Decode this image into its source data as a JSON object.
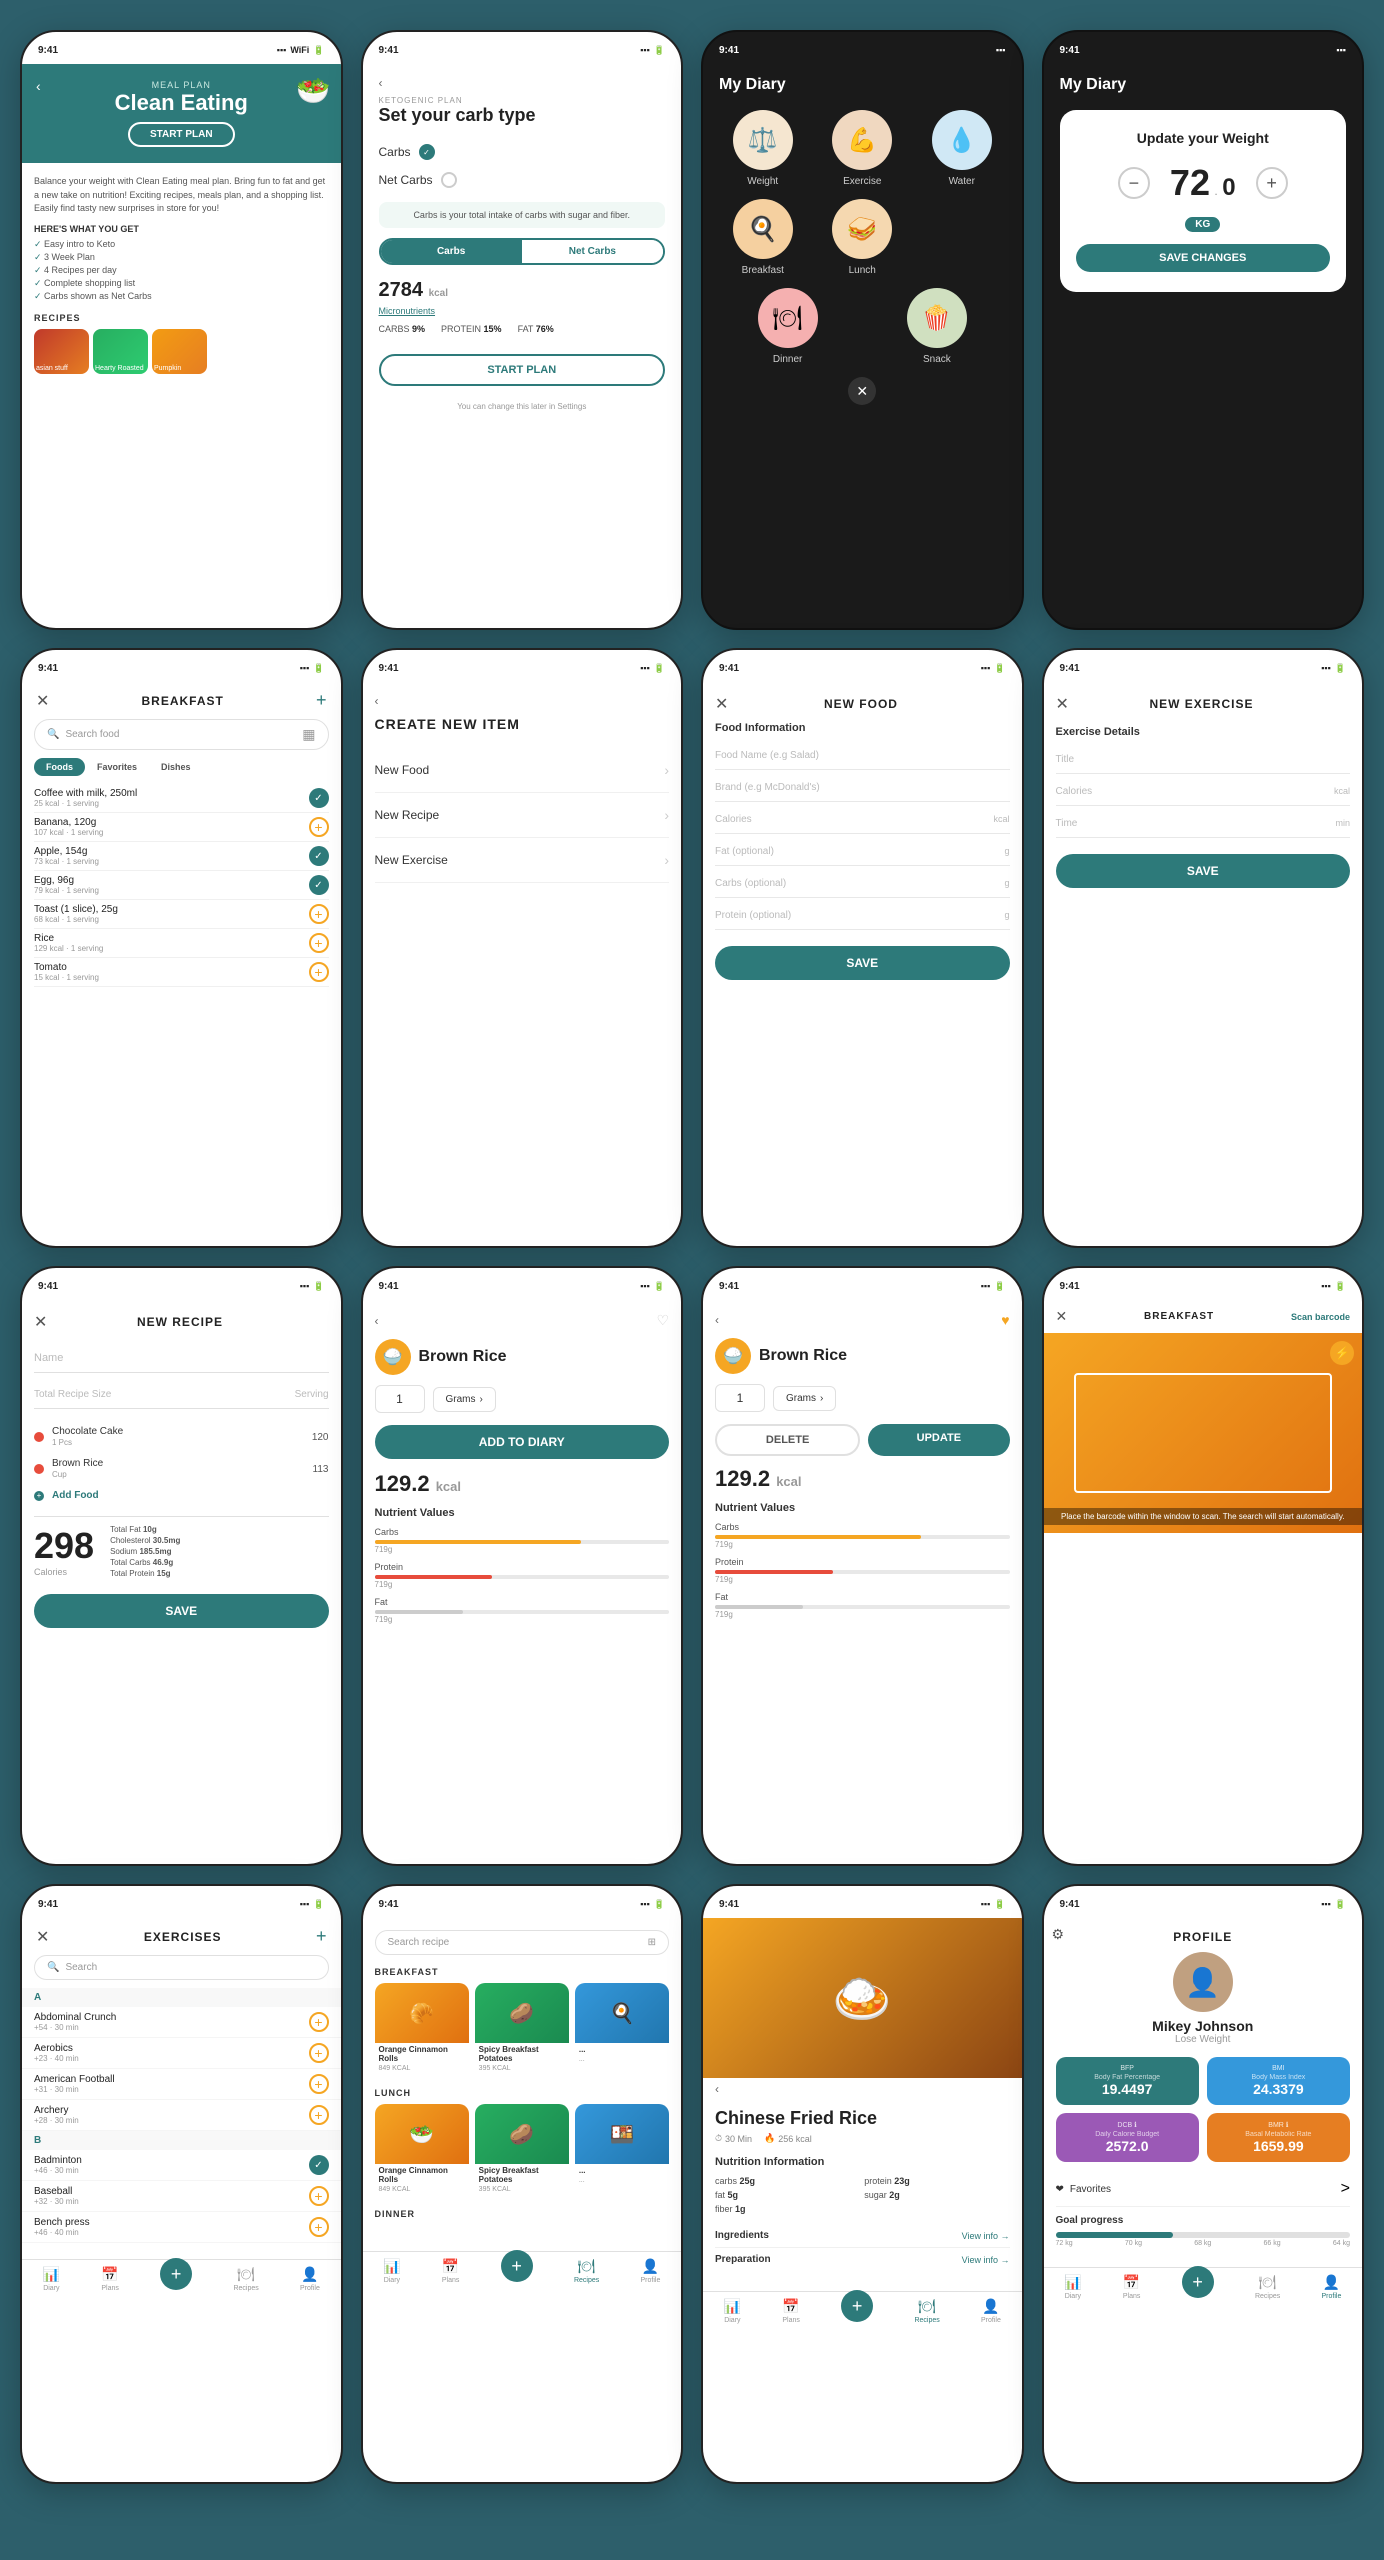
{
  "row1": {
    "screen1": {
      "label": "MEAL PLAN",
      "title": "Clean Eating",
      "start": "START PLAN",
      "body": "Balance your weight with Clean Eating meal plan. Bring fun to fat and get a new take on nutrition! Exciting recipes, meals plan, and a shopping list. Easily find tasty new surprises in store for you!",
      "hwyg": "HERE'S WHAT YOU GET",
      "checks": [
        "Easy intro to Keto",
        "3 Week Plan",
        "4 Recipes per day",
        "Complete shopping list",
        "Carbs shown as Net Carbs"
      ],
      "recipes": "RECIPES",
      "recipe1": "asian stuff",
      "recipe2": "Hearty Roasted Veggie Salad",
      "recipe3": "Pumpkin"
    },
    "screen2": {
      "back": "<",
      "label": "KETOGENIC PLAN",
      "title": "Set your carb type",
      "carbs": "Carbs",
      "netCarbs": "Net Carbs",
      "info": "Carbs is your total intake of carbs with sugar and fiber.",
      "toggle1": "Carbs",
      "toggle2": "Net Carbs",
      "kcal": "2784",
      "kcalUnit": "kcal",
      "microLink": "Micronutrients",
      "carbsPct": "CARBS   9%",
      "proteinPct": "PROTEIN  15%",
      "fatPct": "FAT  76%",
      "startPlan": "START PLAN",
      "note": "You can change this later in Settings"
    },
    "screen3": {
      "title": "My Diary",
      "weight": "Weight",
      "exercise": "Exercise",
      "water": "Water",
      "breakfast": "Breakfast",
      "lunch": "Lunch",
      "dinner": "Dinner",
      "snack": "Snack"
    },
    "screen4": {
      "title": "My Diary",
      "cardTitle": "Update your Weight",
      "value": "72",
      "decimal": "0",
      "unit": "KG",
      "saveBtn": "SAVE CHANGES"
    }
  },
  "row2": {
    "screen5": {
      "title": "BREAKFAST",
      "searchPlaceholder": "Search food",
      "tab1": "Foods",
      "tab2": "Favorites",
      "tab3": "Dishes",
      "foods": [
        {
          "name": "Coffee with milk, 250ml",
          "meta": "25 kcal · 1 serving",
          "checked": true
        },
        {
          "name": "Banana, 120g",
          "meta": "107 kcal · 1 serving",
          "checked": false
        },
        {
          "name": "Apple, 154g",
          "meta": "73 kcal · 1 serving",
          "checked": true
        },
        {
          "name": "Egg, 96g",
          "meta": "79 kcal · 1 serving",
          "checked": true
        },
        {
          "name": "Toast (1 slice), 25g",
          "meta": "68 kcal · 1 serving",
          "checked": false
        },
        {
          "name": "Rice",
          "meta": "129 kcal · 1 serving",
          "checked": false
        },
        {
          "name": "Tomato",
          "meta": "15 kcal · 1 serving",
          "checked": false
        }
      ]
    },
    "screen6": {
      "back": "<",
      "title": "CREATE NEW ITEM",
      "option1": "New Food",
      "option2": "New Recipe",
      "option3": "New Exercise"
    },
    "screen7": {
      "close": "×",
      "title": "NEW FOOD",
      "sectionTitle": "Food Information",
      "field1": "Food Name (e.g Salad)",
      "field2": "Brand (e.g McDonald's)",
      "field3": "Calories",
      "field3Unit": "kcal",
      "field4": "Fat (optional)",
      "field4Unit": "g",
      "field5": "Carbs (optional)",
      "field5Unit": "g",
      "field6": "Protein (optional)",
      "field6Unit": "g",
      "saveBtn": "SAVE"
    },
    "screen8": {
      "close": "×",
      "title": "NEW EXERCISE",
      "sectionTitle": "Exercise Details",
      "field1": "Title",
      "field2": "Calories",
      "field2Unit": "kcal",
      "field3": "Time",
      "field3Unit": "min",
      "saveBtn": "SAVE"
    }
  },
  "row3": {
    "screen9": {
      "close": "×",
      "title": "NEW RECIPE",
      "namePlaceholder": "Name",
      "sizeLabel": "Total Recipe Size",
      "sizeUnit": "Serving",
      "foods": [
        {
          "color": "red",
          "name": "Chocolate Cake",
          "sub": "1 Pcs",
          "cal": 120
        },
        {
          "color": "red",
          "name": "Brown Rice",
          "sub": "Cup",
          "cal": 113
        }
      ],
      "addFood": "Add Food",
      "totalCal": "298",
      "calLabel": "Calories",
      "stats": [
        {
          "label": "Total Fat",
          "val": "10g"
        },
        {
          "label": "Cholesterol",
          "val": "30.5mg"
        },
        {
          "label": "Sodium",
          "val": "185.5mg"
        },
        {
          "label": "Total Carbs",
          "val": "46.9g"
        },
        {
          "label": "Total Protein",
          "val": "15g"
        }
      ],
      "saveBtn": "SAVE"
    },
    "screen10": {
      "back": "<",
      "heartIcon": "♡",
      "foodName": "Brown Rice",
      "qty": "1",
      "unit": "Grams",
      "addBtn": "ADD TO DIARY",
      "kcal": "129.2",
      "kcalUnit": "kcal",
      "nutrientsTitle": "Nutrient Values",
      "nutrients": [
        {
          "name": "Carbs",
          "val": "719g",
          "pct": 70
        },
        {
          "name": "Protein",
          "val": "719g",
          "pct": 40
        },
        {
          "name": "Fat",
          "val": "719g",
          "pct": 30
        }
      ]
    },
    "screen11": {
      "back": "<",
      "heartIcon": "♡",
      "foodName": "Brown Rice",
      "qty": "1",
      "unit": "Grams",
      "deleteBtn": "DELETE",
      "updateBtn": "UPDATE",
      "kcal": "129.2",
      "kcalUnit": "kcal",
      "nutrientsTitle": "Nutrient Values",
      "nutrients": [
        {
          "name": "Carbs",
          "val": "719g",
          "pct": 70
        },
        {
          "name": "Protein",
          "val": "719g",
          "pct": 40
        },
        {
          "name": "Fat",
          "val": "719g",
          "pct": 30
        }
      ]
    },
    "screen12": {
      "close": "×",
      "title": "BREAKFAST",
      "scanLink": "Scan barcode",
      "scanNote": "Place the barcode within the window to scan. The search will start automatically.",
      "lightning": "⚡"
    }
  },
  "row4": {
    "screen13": {
      "close": "×",
      "title": "EXERCISES",
      "plus": "+",
      "searchPlaceholder": "Search",
      "sections": [
        {
          "letter": "A",
          "items": [
            {
              "name": "Abdominal Crunch",
              "meta": "+54 · 30 min",
              "checked": false
            },
            {
              "name": "Aerobics",
              "meta": "+23 · 40 min",
              "checked": false
            },
            {
              "name": "American Football",
              "meta": "+31 · 30 min",
              "checked": false
            },
            {
              "name": "Archery",
              "meta": "+28 · 30 min",
              "checked": false
            }
          ]
        },
        {
          "letter": "B",
          "items": [
            {
              "name": "Badminton",
              "meta": "+46 · 30 min",
              "checked": true
            },
            {
              "name": "Baseball",
              "meta": "+32 · 30 min",
              "checked": false
            },
            {
              "name": "Bench press",
              "meta": "+46 · 40 min",
              "checked": false
            }
          ]
        }
      ]
    },
    "screen14": {
      "searchPlaceholder": "Search recipe",
      "sections": [
        {
          "title": "BREAKFAST",
          "cards": [
            {
              "name": "Orange Cinnamon Rolls",
              "cal": "849 KCAL",
              "emoji": "🥐"
            },
            {
              "name": "Spicy Breakfast Potatoes",
              "cal": "395 KCAL",
              "emoji": "🥔"
            },
            {
              "name": "...",
              "cal": "...",
              "emoji": "🍳"
            }
          ]
        },
        {
          "title": "LUNCH",
          "cards": [
            {
              "name": "Orange Cinnamon Rolls",
              "cal": "849 KCAL",
              "emoji": "🥗"
            },
            {
              "name": "Spicy Breakfast Potatoes",
              "cal": "395 KCAL",
              "emoji": "🥔"
            },
            {
              "name": "...",
              "cal": "...",
              "emoji": "🍱"
            }
          ]
        },
        {
          "title": "DINNER",
          "cards": []
        }
      ]
    },
    "screen15": {
      "title": "Chinese Fried Rice",
      "meta1": "30 Min",
      "meta2": "256 kcal",
      "nutritionTitle": "Nutrition Information",
      "nutrients": [
        {
          "label": "carbs",
          "val": "25g"
        },
        {
          "label": "protein",
          "val": "23g"
        },
        {
          "label": "fat",
          "val": "5g"
        },
        {
          "label": "sugar",
          "val": "2g"
        },
        {
          "label": "fiber",
          "val": "1g"
        }
      ],
      "ingredientsLabel": "Ingredients",
      "viewInfo": "View info →",
      "prepLabel": "Preparation",
      "viewInfo2": "View info →"
    },
    "screen16": {
      "profileTitle": "PROFILE",
      "name": "Mikey Johnson",
      "goal": "Lose Weight",
      "stats": [
        {
          "label": "BFP",
          "sublabel": "Body Fat Percentage",
          "value": "19.4497",
          "color": "teal"
        },
        {
          "label": "BMI",
          "sublabel": "Body Mass Index",
          "value": "24.3379",
          "color": "blue"
        },
        {
          "label": "DCB",
          "sublabel": "Daily Calorie Budget",
          "value": "2572.0",
          "color": "purple"
        },
        {
          "label": "BMR",
          "sublabel": "Basal Metabolic Rate",
          "value": "1659.99",
          "color": "orange"
        }
      ],
      "favoritesLabel": "Favorites",
      "favoritesLink": ">",
      "goalTitle": "Goal progress",
      "goalLabels": [
        "72 kg",
        "70 kg",
        "68 kg",
        "66 kg",
        "64 kg"
      ]
    }
  },
  "nav": {
    "items": [
      "📊",
      "📅",
      "➕",
      "🍽",
      "👤"
    ],
    "labels": [
      "Diary",
      "Plans",
      "",
      "Recipes",
      "Profile"
    ]
  }
}
